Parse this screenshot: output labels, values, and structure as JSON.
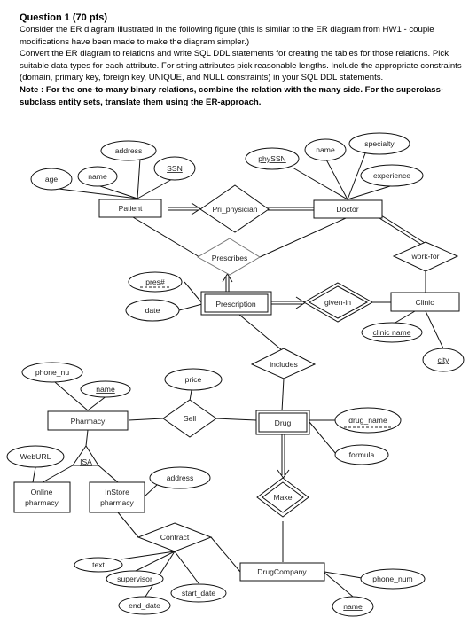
{
  "question": {
    "title": "Question 1 (70 pts)",
    "paragraph1": "Consider the ER diagram illustrated in the following figure (this is similar to the ER diagram from HW1 - couple modifications have been made to make the diagram simpler.)",
    "paragraph2": "Convert the ER diagram to relations and write SQL DDL statements for creating the tables for those relations. Pick suitable data types for each attribute. For string attributes pick reasonable lengths. Include the appropriate constraints (domain, primary key, foreign key, UNIQUE, and NULL constraints) in your SQL DDL statements.",
    "note": "Note : For the one-to-many binary relations, combine the relation with the many side. For the superclass-subclass entity sets, translate them using the ER-approach."
  },
  "diagram": {
    "entities": {
      "patient": "Patient",
      "doctor": "Doctor",
      "prescription": "Prescription",
      "clinic": "Clinic",
      "pharmacy": "Pharmacy",
      "drug": "Drug",
      "online_pharmacy_l1": "Online",
      "online_pharmacy_l2": "pharmacy",
      "instore_pharmacy_l1": "InStore",
      "instore_pharmacy_l2": "pharmacy",
      "drug_company": "DrugCompany"
    },
    "relationships": {
      "pri_physician": "Pri_physician",
      "prescribes": "Prescribes",
      "given_in": "given-in",
      "work_for": "work-for",
      "includes": "includes",
      "sell": "Sell",
      "make": "Make",
      "contract": "Contract",
      "isa": "ISA"
    },
    "attributes": {
      "patient_address": "address",
      "patient_name": "name",
      "patient_ssn": "SSN",
      "patient_age": "age",
      "doctor_physsn": "phySSN",
      "doctor_name": "name",
      "doctor_specialty": "specialty",
      "doctor_experience": "experience",
      "prescription_pres": "pres#",
      "prescription_date": "date",
      "clinic_name": "clinic name",
      "clinic_city": "city",
      "pharmacy_phone": "phone_nu",
      "pharmacy_name": "name",
      "sell_price": "price",
      "drug_name": "drug_name",
      "drug_formula": "formula",
      "online_weburl": "WebURL",
      "instore_address": "address",
      "contract_text": "text",
      "contract_supervisor": "supervisor",
      "contract_end_date": "end_date",
      "contract_start_date": "start_date",
      "company_phone": "phone_num",
      "company_name": "name"
    }
  }
}
